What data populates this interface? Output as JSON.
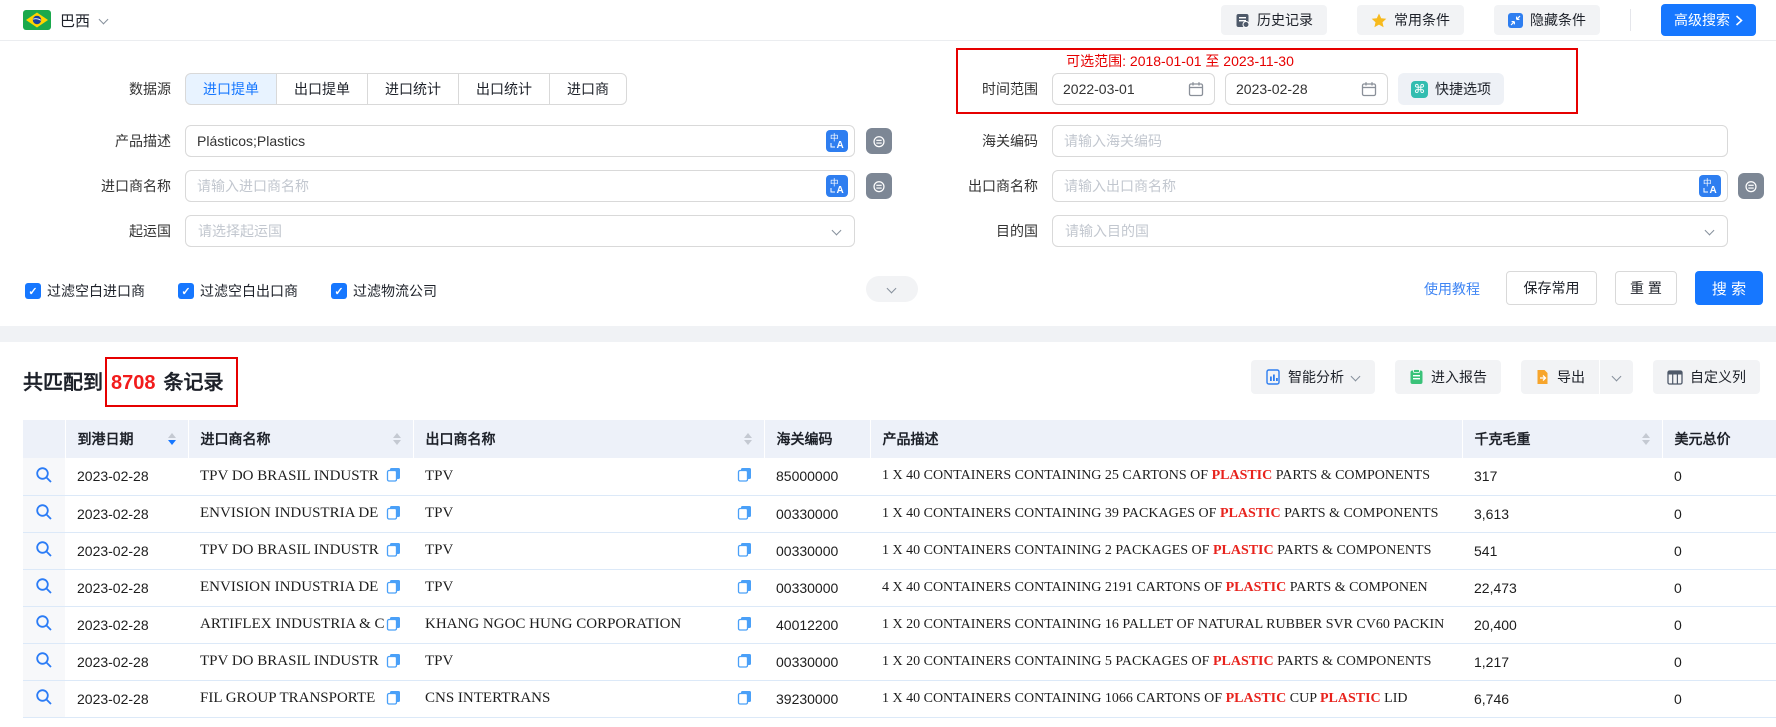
{
  "topbar": {
    "country": "巴西",
    "history_label": "历史记录",
    "favorites_label": "常用条件",
    "hide_label": "隐藏条件",
    "advanced_search_label": "高级搜索"
  },
  "form": {
    "datasource_label": "数据源",
    "tabs": [
      {
        "label": "进口提单",
        "active": true
      },
      {
        "label": "出口提单",
        "active": false
      },
      {
        "label": "进口统计",
        "active": false
      },
      {
        "label": "出口统计",
        "active": false
      },
      {
        "label": "进口商",
        "active": false
      }
    ],
    "available_range": "可选范围: 2018-01-01 至 2023-11-30",
    "time_range_label": "时间范围",
    "date_from": "2022-03-01",
    "date_to": "2023-02-28",
    "quick_options_label": "快捷选项",
    "product_desc": {
      "label": "产品描述",
      "value": "Plásticos;Plastics"
    },
    "hs_code": {
      "label": "海关编码",
      "placeholder": "请输入海关编码"
    },
    "importer": {
      "label": "进口商名称",
      "placeholder": "请输入进口商名称"
    },
    "exporter": {
      "label": "出口商名称",
      "placeholder": "请输入出口商名称"
    },
    "origin_country": {
      "label": "起运国",
      "placeholder": "请选择起运国"
    },
    "dest_country": {
      "label": "目的国",
      "placeholder": "请输入目的国"
    },
    "checkboxes": [
      {
        "label": "过滤空白进口商",
        "checked": true
      },
      {
        "label": "过滤空白出口商",
        "checked": true
      },
      {
        "label": "过滤物流公司",
        "checked": true
      }
    ],
    "tutorial_label": "使用教程",
    "save_label": "保存常用",
    "reset_label": "重 置",
    "search_label": "搜 索"
  },
  "results": {
    "match_prefix": "共匹配到",
    "count": "8708",
    "match_suffix": "条记录",
    "actions": {
      "analysis_label": "智能分析",
      "report_label": "进入报告",
      "export_label": "导出",
      "custom_columns_label": "自定义列"
    },
    "table": {
      "columns": [
        {
          "label": "",
          "sortable": false,
          "sort": ""
        },
        {
          "label": "到港日期",
          "sortable": true,
          "sort": "desc"
        },
        {
          "label": "进口商名称",
          "sortable": true,
          "sort": ""
        },
        {
          "label": "出口商名称",
          "sortable": true,
          "sort": ""
        },
        {
          "label": "海关编码",
          "sortable": false,
          "sort": ""
        },
        {
          "label": "产品描述",
          "sortable": false,
          "sort": ""
        },
        {
          "label": "千克毛重",
          "sortable": true,
          "sort": ""
        },
        {
          "label": "美元总价",
          "sortable": false,
          "sort": ""
        }
      ],
      "rows": [
        {
          "date": "2023-02-28",
          "importer": "TPV DO BRASIL INDUSTR",
          "exporter": "TPV",
          "hs_code": "85000000",
          "desc_parts": [
            {
              "t": "1 X 40 CONTAINERS CONTAINING 25 CARTONS OF ",
              "hl": false
            },
            {
              "t": "PLASTIC",
              "hl": true
            },
            {
              "t": " PARTS & COMPONENTS",
              "hl": false
            }
          ],
          "weight": "317",
          "value": "0"
        },
        {
          "date": "2023-02-28",
          "importer": "ENVISION INDUSTRIA DE",
          "exporter": "TPV",
          "hs_code": "00330000",
          "desc_parts": [
            {
              "t": "1 X 40 CONTAINERS CONTAINING 39 PACKAGES OF ",
              "hl": false
            },
            {
              "t": "PLASTIC",
              "hl": true
            },
            {
              "t": " PARTS & COMPONENTS",
              "hl": false
            }
          ],
          "weight": "3,613",
          "value": "0"
        },
        {
          "date": "2023-02-28",
          "importer": "TPV DO BRASIL INDUSTR",
          "exporter": "TPV",
          "hs_code": "00330000",
          "desc_parts": [
            {
              "t": "1 X 40 CONTAINERS CONTAINING 2 PACKAGES OF ",
              "hl": false
            },
            {
              "t": "PLASTIC",
              "hl": true
            },
            {
              "t": " PARTS & COMPONENTS",
              "hl": false
            }
          ],
          "weight": "541",
          "value": "0"
        },
        {
          "date": "2023-02-28",
          "importer": "ENVISION INDUSTRIA DE",
          "exporter": "TPV",
          "hs_code": "00330000",
          "desc_parts": [
            {
              "t": "4 X 40 CONTAINERS CONTAINING 2191 CARTONS OF ",
              "hl": false
            },
            {
              "t": "PLASTIC",
              "hl": true
            },
            {
              "t": " PARTS & COMPONEN",
              "hl": false
            }
          ],
          "weight": "22,473",
          "value": "0"
        },
        {
          "date": "2023-02-28",
          "importer": "ARTIFLEX INDUSTRIA & C",
          "exporter": "KHANG NGOC HUNG CORPORATION",
          "hs_code": "40012200",
          "desc_parts": [
            {
              "t": "1 X 20 CONTAINERS CONTAINING 16 PALLET OF NATURAL RUBBER SVR CV60 PACKIN",
              "hl": false
            }
          ],
          "weight": "20,400",
          "value": "0"
        },
        {
          "date": "2023-02-28",
          "importer": "TPV DO BRASIL INDUSTR",
          "exporter": "TPV",
          "hs_code": "00330000",
          "desc_parts": [
            {
              "t": "1 X 20 CONTAINERS CONTAINING 5 PACKAGES OF ",
              "hl": false
            },
            {
              "t": "PLASTIC",
              "hl": true
            },
            {
              "t": " PARTS & COMPONENTS",
              "hl": false
            }
          ],
          "weight": "1,217",
          "value": "0"
        },
        {
          "date": "2023-02-28",
          "importer": "FIL GROUP TRANSPORTE",
          "exporter": "CNS INTERTRANS",
          "hs_code": "39230000",
          "desc_parts": [
            {
              "t": "1 X 40 CONTAINERS CONTAINING 1066 CARTONS OF ",
              "hl": false
            },
            {
              "t": "PLASTIC",
              "hl": true
            },
            {
              "t": " CUP ",
              "hl": false
            },
            {
              "t": "PLASTIC",
              "hl": true
            },
            {
              "t": " LID",
              "hl": false
            }
          ],
          "weight": "6,746",
          "value": "0"
        }
      ]
    }
  }
}
